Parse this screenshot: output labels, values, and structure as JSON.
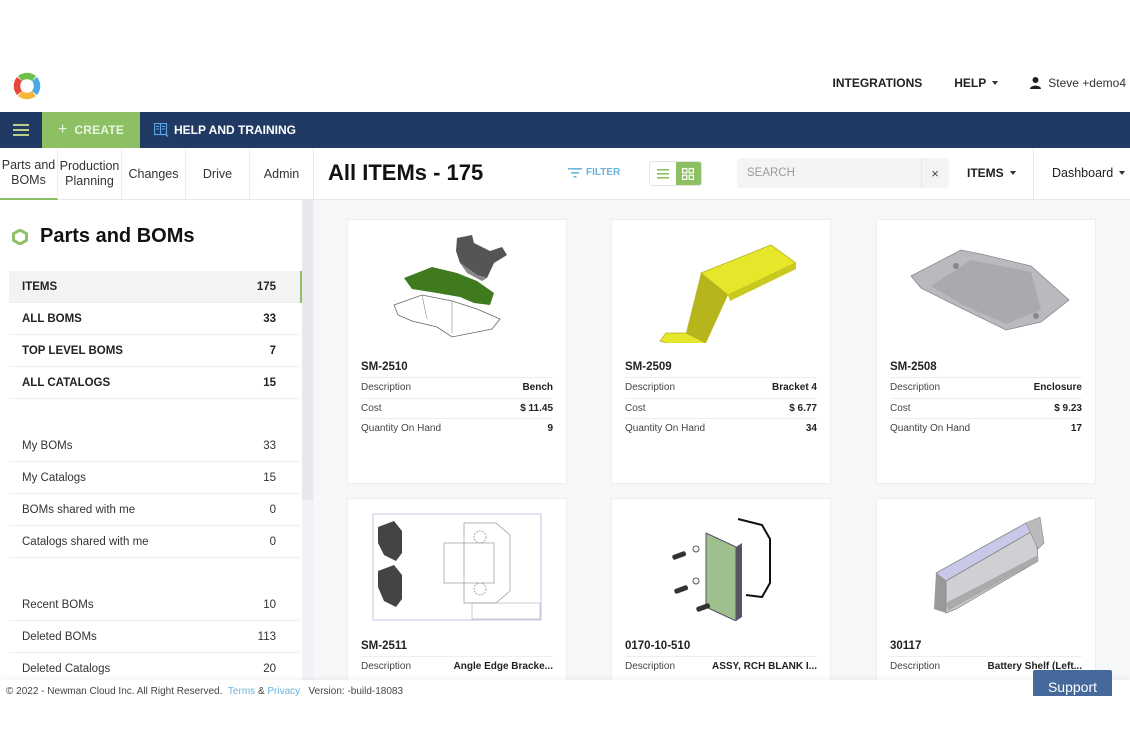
{
  "header": {
    "logo": "app-logo",
    "links": [
      {
        "label": "INTEGRATIONS",
        "dropdown": false
      },
      {
        "label": "HELP",
        "dropdown": true
      }
    ],
    "user": {
      "icon": "user-icon",
      "name": "Steve +demo4"
    }
  },
  "navbar": {
    "menu_icon": "hamburger-icon",
    "create_label": "CREATE",
    "help_training_label": "HELP AND TRAINING",
    "colors": {
      "bar": "#203a64",
      "create": "#8cc063"
    }
  },
  "tabs": [
    {
      "label": "Parts and BOMs",
      "active": true
    },
    {
      "label": "Production Planning",
      "active": false
    },
    {
      "label": "Changes",
      "active": false
    },
    {
      "label": "Drive",
      "active": false
    },
    {
      "label": "Admin",
      "active": false
    }
  ],
  "toolbar": {
    "title": "All ITEMs - 175",
    "filter_label": "FILTER",
    "view_modes": [
      "list",
      "grid"
    ],
    "active_view": "grid",
    "search_placeholder": "SEARCH",
    "search_value": "",
    "clear_label": "×",
    "type_selected": "ITEMS",
    "dashboard_label": "Dashboard"
  },
  "sidebar": {
    "heading": "Parts and BOMs",
    "primary": [
      {
        "label": "ITEMS",
        "count": "175",
        "active": true
      },
      {
        "label": "ALL BOMS",
        "count": "33"
      },
      {
        "label": "TOP LEVEL BOMS",
        "count": "7"
      },
      {
        "label": "ALL CATALOGS",
        "count": "15"
      }
    ],
    "mine": [
      {
        "label": "My BOMs",
        "count": "33"
      },
      {
        "label": "My Catalogs",
        "count": "15"
      },
      {
        "label": "BOMs shared with me",
        "count": "0"
      },
      {
        "label": "Catalogs shared with me",
        "count": "0"
      }
    ],
    "other": [
      {
        "label": "Recent BOMs",
        "count": "10"
      },
      {
        "label": "Deleted BOMs",
        "count": "113"
      },
      {
        "label": "Deleted Catalogs",
        "count": "20"
      }
    ]
  },
  "cards": [
    {
      "id": "SM-2510",
      "image": "sheet-metal-bench-flat-pattern",
      "fields": [
        {
          "label": "Description",
          "value": "Bench"
        },
        {
          "label": "Cost",
          "value": "$ 11.45"
        },
        {
          "label": "Quantity On Hand",
          "value": "9"
        }
      ]
    },
    {
      "id": "SM-2509",
      "image": "yellow-bracket",
      "fields": [
        {
          "label": "Description",
          "value": "Bracket 4"
        },
        {
          "label": "Cost",
          "value": "$ 6.77"
        },
        {
          "label": "Quantity On Hand",
          "value": "34"
        }
      ]
    },
    {
      "id": "SM-2508",
      "image": "grey-enclosure-plate",
      "fields": [
        {
          "label": "Description",
          "value": "Enclosure"
        },
        {
          "label": "Cost",
          "value": "$ 9.23"
        },
        {
          "label": "Quantity On Hand",
          "value": "17"
        }
      ]
    },
    {
      "id": "SM-2511",
      "image": "angle-edge-bracket-drawing",
      "fields": [
        {
          "label": "Description",
          "value": "Angle Edge Bracke..."
        }
      ]
    },
    {
      "id": "0170-10-510",
      "image": "pcb-assembly-exploded",
      "fields": [
        {
          "label": "Description",
          "value": "ASSY, RCH BLANK I..."
        }
      ]
    },
    {
      "id": "30117",
      "image": "battery-shelf",
      "fields": [
        {
          "label": "Description",
          "value": "Battery Shelf (Left..."
        }
      ]
    }
  ],
  "footer": {
    "copyright": "© 2022 - Newman Cloud Inc. All Right Reserved.",
    "terms": "Terms",
    "amp": "&",
    "privacy": "Privacy",
    "version": "Version: -build-18083"
  },
  "support_label": "Support"
}
